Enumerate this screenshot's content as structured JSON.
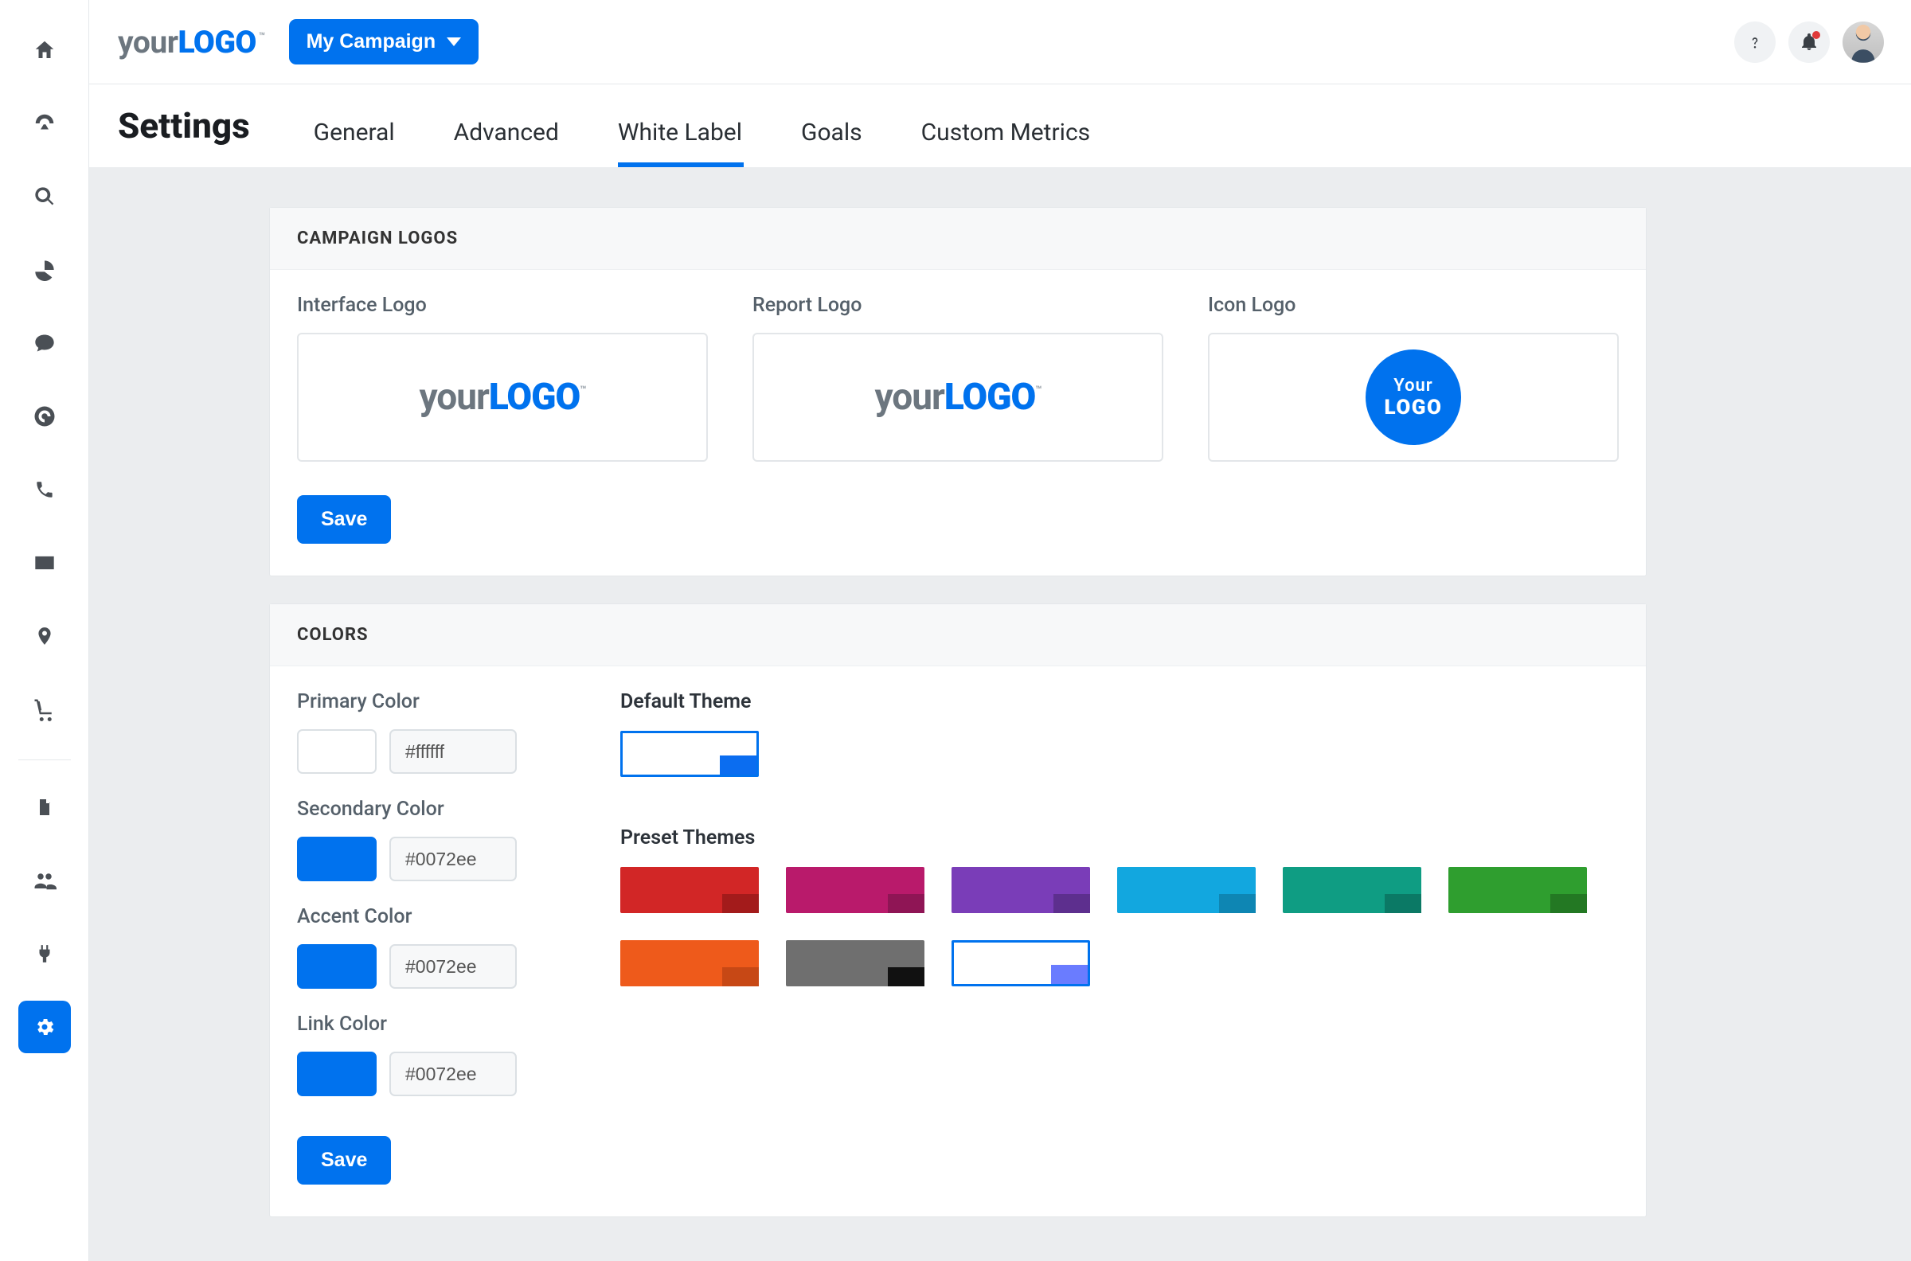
{
  "brand": {
    "w1": "your",
    "w2": "LOGO",
    "tm": "™"
  },
  "header": {
    "campaign_label": "My Campaign"
  },
  "page": {
    "title": "Settings"
  },
  "tabs": [
    {
      "label": "General",
      "active": false
    },
    {
      "label": "Advanced",
      "active": false
    },
    {
      "label": "White Label",
      "active": true
    },
    {
      "label": "Goals",
      "active": false
    },
    {
      "label": "Custom Metrics",
      "active": false
    }
  ],
  "logos_card": {
    "title": "CAMPAIGN LOGOS",
    "items": [
      {
        "label": "Interface Logo"
      },
      {
        "label": "Report Logo"
      },
      {
        "label": "Icon Logo"
      }
    ],
    "icon_circle": {
      "line1": "Your",
      "line2": "LOGO"
    },
    "save": "Save"
  },
  "colors_card": {
    "title": "COLORS",
    "primary": {
      "label": "Primary Color",
      "hex": "#ffffff",
      "swatch": "#ffffff"
    },
    "secondary": {
      "label": "Secondary Color",
      "hex": "#0072ee",
      "swatch": "#0072ee"
    },
    "accent": {
      "label": "Accent Color",
      "hex": "#0072ee",
      "swatch": "#0072ee"
    },
    "link": {
      "label": "Link Color",
      "hex": "#0072ee",
      "swatch": "#0072ee"
    },
    "default_theme_label": "Default Theme",
    "default_theme": {
      "outlined": true,
      "main": "#ffffff",
      "corner": "#0b6df0"
    },
    "preset_label": "Preset Themes",
    "presets": [
      {
        "main": "#d22626",
        "corner": "#a31b1b"
      },
      {
        "main": "#b91a6b",
        "corner": "#8f1555"
      },
      {
        "main": "#7a3db8",
        "corner": "#5d2f8e"
      },
      {
        "main": "#12a7df",
        "corner": "#0e86b3"
      },
      {
        "main": "#0f9d83",
        "corner": "#0b7965"
      },
      {
        "main": "#2f9e2f",
        "corner": "#237823"
      },
      {
        "main": "#ee5a1b",
        "corner": "#c74815"
      },
      {
        "main": "#6f6f6f",
        "corner": "#111111"
      },
      {
        "outlined": true,
        "main": "#ffffff",
        "corner": "#6a7cff"
      }
    ],
    "save": "Save"
  }
}
